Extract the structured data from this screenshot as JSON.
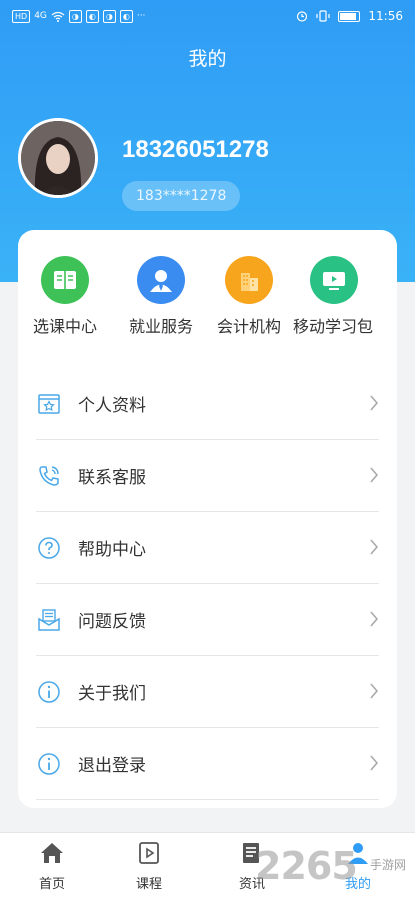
{
  "status_bar": {
    "left_icons": [
      "HD",
      "4G",
      "wifi-icon",
      "app-icon",
      "app-icon",
      "app-icon",
      "app-icon"
    ],
    "more": "···",
    "time": "11:56"
  },
  "header": {
    "title": "我的"
  },
  "profile": {
    "phone": "18326051278",
    "masked_phone": "183****1278"
  },
  "quick_actions": [
    {
      "label": "选课中心",
      "icon": "book-icon",
      "color": "#3ec258"
    },
    {
      "label": "就业服务",
      "icon": "user-icon",
      "color": "#3a8cf0"
    },
    {
      "label": "会计机构",
      "icon": "building-icon",
      "color": "#f7a51c"
    },
    {
      "label": "移动学习包",
      "icon": "video-icon",
      "color": "#29c184"
    }
  ],
  "menu": [
    {
      "label": "个人资料",
      "icon": "profile-card-icon"
    },
    {
      "label": "联系客服",
      "icon": "phone-icon"
    },
    {
      "label": "帮助中心",
      "icon": "question-icon"
    },
    {
      "label": "问题反馈",
      "icon": "mail-icon"
    },
    {
      "label": "关于我们",
      "icon": "info-icon"
    },
    {
      "label": "退出登录",
      "icon": "info-icon"
    }
  ],
  "tabs": [
    {
      "label": "首页",
      "icon": "home-icon"
    },
    {
      "label": "课程",
      "icon": "course-icon"
    },
    {
      "label": "资讯",
      "icon": "news-icon"
    },
    {
      "label": "我的",
      "icon": "user-icon",
      "active": true
    }
  ],
  "watermark": {
    "number": "2265",
    "text": "手游网"
  },
  "colors": {
    "accent": "#2f9cf5",
    "icon_blue": "#4aa8e8"
  }
}
